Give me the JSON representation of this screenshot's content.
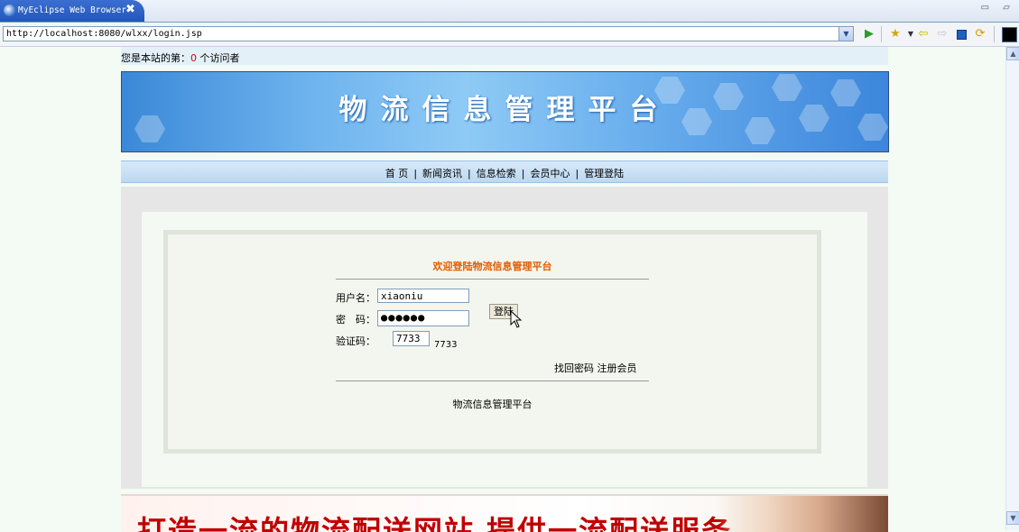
{
  "browser": {
    "tab_title": "MyEclipse Web Browser",
    "tab_close": "✖",
    "url": "http://localhost:8080/wlxx/login.jsp",
    "window_controls": "▭ ▱",
    "icons": [
      "globe-icon",
      "go-icon",
      "favorites-icon",
      "back-icon",
      "forward-icon",
      "stop-icon",
      "refresh-icon"
    ]
  },
  "visitor": {
    "prefix": "您是本站的第：",
    "count": "0",
    "suffix": " 个访问者"
  },
  "banner": {
    "title": "物流信息管理平台"
  },
  "nav": {
    "items": [
      "首 页",
      "新闻资讯",
      "信息检索",
      "会员中心",
      "管理登陆"
    ],
    "separator": "|"
  },
  "login": {
    "welcome": "欢迎登陆物流信息管理平台",
    "username_label": "用户名：",
    "username_value": "xiaoniu",
    "password_label": "密　码：",
    "password_value": "●●●●●●",
    "code_label": "验证码：",
    "code_value": "7733",
    "code_display": "7733",
    "login_button": "登陆",
    "forgot_link": "找回密码",
    "register_link": "注册会员",
    "footer": "物流信息管理平台"
  },
  "ad": {
    "text": "打造一流的物流配送网站 提供一流配送服务"
  },
  "colors": {
    "accent_orange": "#e05c00",
    "counter_red": "#e00000",
    "banner_blue": "#3a88d8"
  }
}
